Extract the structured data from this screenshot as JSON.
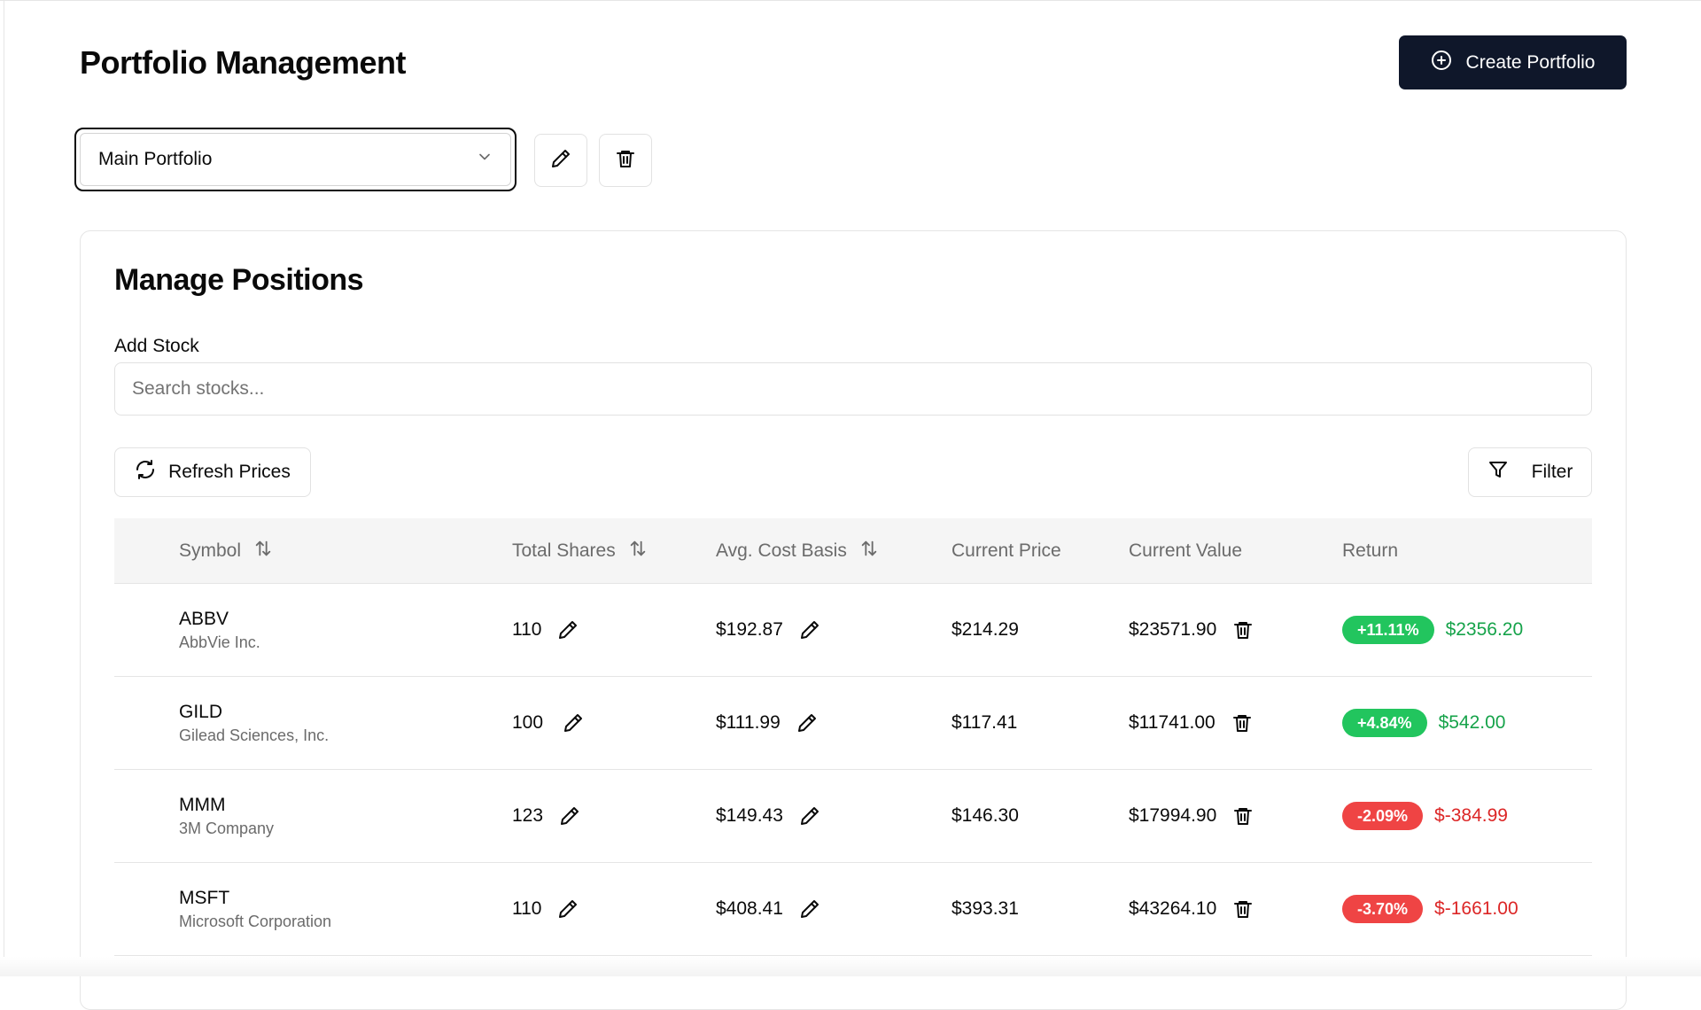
{
  "header": {
    "title": "Portfolio Management",
    "create_button": "Create Portfolio"
  },
  "portfolio_selector": {
    "selected": "Main Portfolio"
  },
  "positions_card": {
    "title": "Manage Positions",
    "add_stock_label": "Add Stock",
    "search_placeholder": "Search stocks...",
    "refresh_button": "Refresh Prices",
    "filter_button": "Filter"
  },
  "table": {
    "columns": {
      "symbol": "Symbol",
      "total_shares": "Total Shares",
      "avg_cost": "Avg. Cost Basis",
      "current_price": "Current Price",
      "current_value": "Current Value",
      "return": "Return"
    },
    "rows": [
      {
        "ticker": "ABBV",
        "company": "AbbVie Inc.",
        "shares": "110",
        "avg_cost": "$192.87",
        "price": "$214.29",
        "value": "$23571.90",
        "return_pct": "+11.11%",
        "return_amt": "$2356.20",
        "direction": "pos"
      },
      {
        "ticker": "GILD",
        "company": "Gilead Sciences, Inc.",
        "shares": "100",
        "avg_cost": "$111.99",
        "price": "$117.41",
        "value": "$11741.00",
        "return_pct": "+4.84%",
        "return_amt": "$542.00",
        "direction": "pos"
      },
      {
        "ticker": "MMM",
        "company": "3M Company",
        "shares": "123",
        "avg_cost": "$149.43",
        "price": "$146.30",
        "value": "$17994.90",
        "return_pct": "-2.09%",
        "return_amt": "$-384.99",
        "direction": "neg"
      },
      {
        "ticker": "MSFT",
        "company": "Microsoft Corporation",
        "shares": "110",
        "avg_cost": "$408.41",
        "price": "$393.31",
        "value": "$43264.10",
        "return_pct": "-3.70%",
        "return_amt": "$-1661.00",
        "direction": "neg"
      }
    ]
  },
  "colors": {
    "primary_button": "#0f172a",
    "positive_badge": "#22c55e",
    "positive_text": "#16a34a",
    "negative_badge": "#ef4444",
    "negative_text": "#dc2626"
  },
  "icons": {
    "create": "plus-circle-icon",
    "dropdown": "chevron-down-icon",
    "edit": "pencil-icon",
    "delete": "trash-icon",
    "refresh": "refresh-icon",
    "filter": "filter-icon",
    "sort": "sort-arrows-icon"
  }
}
